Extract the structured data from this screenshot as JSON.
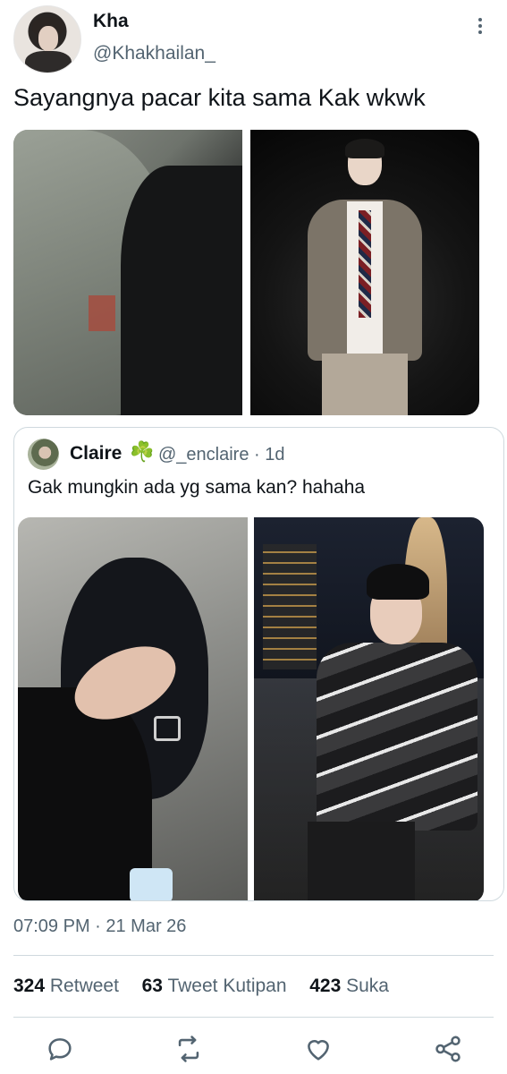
{
  "author": {
    "name": "Kha",
    "handle": "@Khakhailan_"
  },
  "tweet": {
    "text": "Sayangnya pacar kita sama Kak wkwk"
  },
  "quoted": {
    "name": "Claire",
    "badge_emoji": "☘️",
    "handle_time": "@_enclaire · 1d",
    "text": "Gak mungkin ada yg sama kan? hahaha"
  },
  "meta": {
    "timestamp": "07:09 PM · 21 Mar 26"
  },
  "stats": {
    "retweets": "324",
    "retweets_label": "Retweet",
    "quotes": "63",
    "quotes_label": "Tweet Kutipan",
    "likes": "423",
    "likes_label": "Suka"
  },
  "icons": {
    "more": "more-vertical-icon",
    "reply": "reply-icon",
    "retweet": "retweet-icon",
    "like": "heart-icon",
    "share": "share-icon"
  },
  "colors": {
    "text": "#0f1419",
    "muted": "#536471",
    "border": "#cfd9de"
  }
}
